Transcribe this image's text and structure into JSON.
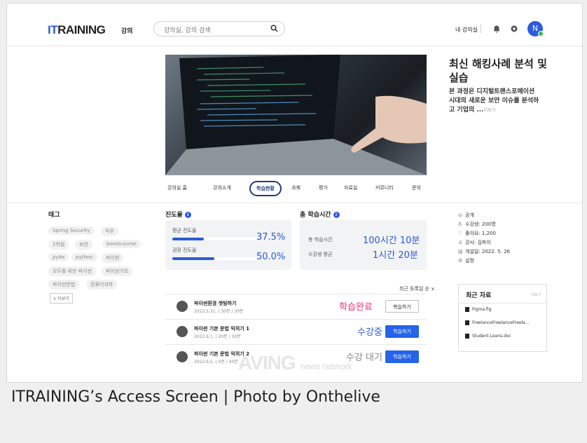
{
  "header": {
    "logo_it": "IT",
    "logo_rest": "RAINING",
    "nav_lecture": "강의",
    "search_placeholder": "강의실, 강의 검색",
    "my_lectures": "내 강의실",
    "avatar_initial": "N"
  },
  "hero": {
    "title": "최신 해킹사례 분석 및 실습",
    "description": "본 과정은 디지털트랜스포메이션 시대의 새로운 보안 이슈를 분석하고 기업의 ...",
    "more": "더보기"
  },
  "tabs": [
    "강의실 홈",
    "강의소개",
    "학습현황",
    "과제",
    "평가",
    "자료실",
    "커뮤니티",
    "문의"
  ],
  "active_tab": "학습현황",
  "tags": {
    "title": "태그",
    "items": [
      "Spring Security",
      "직무",
      "2학점",
      "보안",
      "boostcourse",
      "py4e",
      "python",
      "파이썬",
      "모두를 위한 파이썬",
      "파이썬기초",
      "파이썬문법",
      "컴퓨터과학"
    ],
    "more_button": "∨ 더보기"
  },
  "progress": {
    "title": "진도율",
    "avg_label": "평균 진도율",
    "avg_value": "37.5%",
    "avg_fraction": 0.375,
    "rec_label": "권장 진도율",
    "rec_value": "50.0%",
    "rec_fraction": 0.5
  },
  "study_time": {
    "title": "총 학습시간",
    "total_label": "총 학습시간",
    "total_value": "100시간 10분",
    "avg_label": "수강생 평균",
    "avg_value": "1시간 20분"
  },
  "meta": [
    "공개",
    "수강생: 200명",
    "좋아요: 1,200",
    "강사: 김파이",
    "개설일: 2022. 5. 26",
    "설정"
  ],
  "courses": {
    "sort_label": "최근 등록일 순 ∨",
    "items": [
      {
        "title": "파이썬환경 셋팅하기",
        "sub": "2022.5.31. | 30분 / 30분",
        "status": "학습완료",
        "status_color": "#e8366f",
        "button": "복습하기",
        "button_style": "outline"
      },
      {
        "title": "파이썬 기본 문법 익히기 1",
        "sub": "2022.6.1. | 20분 / 30분",
        "status": "수강중",
        "status_color": "#2a5bd7",
        "button": "학습하기",
        "button_style": "solid"
      },
      {
        "title": "파이썬 기본 문법 익히기 2",
        "sub": "2022.6.5. | 0분 / 40분",
        "status": "수강 대기",
        "status_color": "#888888",
        "button": "학습하기",
        "button_style": "solid"
      }
    ]
  },
  "recent_files": {
    "title": "최근 자료",
    "more": "더보기",
    "items": [
      "Figma.fig",
      "FreelanceFreelanceFreela...",
      "Student Loans.doc"
    ]
  },
  "watermark": "AVING",
  "watermark_sub": "news network",
  "caption": "ITRAINING’s Access Screen | Photo by Onthelive"
}
